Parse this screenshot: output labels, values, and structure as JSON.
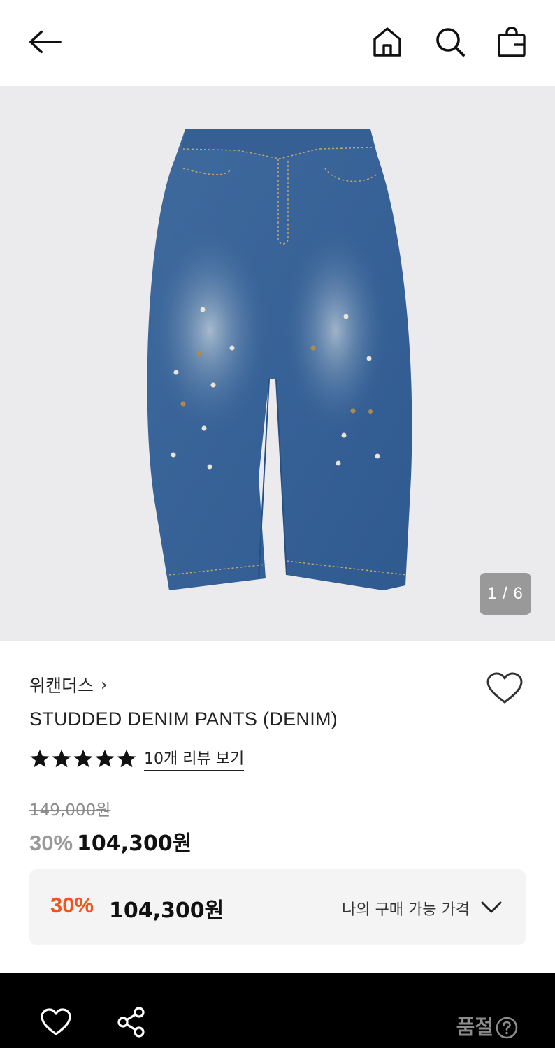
{
  "header": {
    "back_icon": "arrow-left-icon",
    "home_icon": "home-icon",
    "search_icon": "search-icon",
    "cart_icon": "shopping-bag-icon"
  },
  "gallery": {
    "counter": "1 / 6",
    "image_subject": "denim-pants-photo",
    "background_color": "#ebebed"
  },
  "product": {
    "brand": "위캔더스",
    "brand_chevron": "›",
    "name": "STUDDED DENIM PANTS (DENIM)",
    "rating_stars": 5,
    "review_link": "10개 리뷰 보기",
    "original_price": "149,000원",
    "discount_percent": "30%",
    "sale_price": "104,300원",
    "wish_icon": "heart-outline-icon"
  },
  "my_price": {
    "discount_percent": "30%",
    "price": "104,300원",
    "label": "나의 구매 가능 가격",
    "accent_color": "#f2541b"
  },
  "bottom_bar": {
    "heart_icon": "heart-outline-icon",
    "share_icon": "share-icon",
    "status": "품절",
    "help_icon": "question-circle-icon"
  }
}
